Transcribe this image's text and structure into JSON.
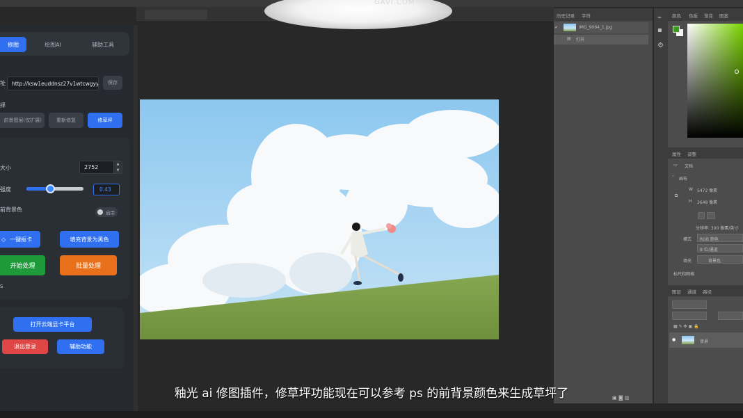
{
  "watermark": {
    "text": "GAVI.COM"
  },
  "plugin": {
    "tabs": [
      "修图",
      "绘图AI",
      "辅助工具"
    ],
    "url_label": "址",
    "url_value": "http://ksw1euddnsz27v1wtcwgyy",
    "save_label": "保存",
    "mode_label": "择",
    "mode_buttons": [
      "前景图层(仅扩展)",
      "重新修复",
      "修草坪"
    ],
    "size_label": "大小",
    "size_value": "2752",
    "strength_label": "强度",
    "strength_value": "0.43",
    "strength_fraction": 0.43,
    "fg_color_label": "前背景色",
    "toggle_label": "启用",
    "btn_one_click": "一键抠卡",
    "btn_fill_bg": "填充背景为黑色",
    "btn_start": "开始处理",
    "btn_batch": "批量处理",
    "stray_char": "S",
    "btn_open_cloud": "打开云端显卡平台",
    "btn_logout": "退出登录",
    "btn_repair": "辅助功能"
  },
  "subtitle": "釉光 ai 修图插件，修草坪功能现在可以参考 ps 的前背景颜色来生成草坪了",
  "ps": {
    "history_tabs": [
      "历史记录",
      "字符"
    ],
    "history_items": [
      "IMG_9064_1.jpg",
      "打开"
    ],
    "right_tabs": [
      "颜色",
      "色板",
      "渐变",
      "图案"
    ],
    "props_tabs": [
      "属性",
      "调整"
    ],
    "doc_label": "文档",
    "canvas_label": "画布",
    "w_label": "W",
    "w_value": "5472 像素",
    "h_label": "H",
    "h_value": "3648 像素",
    "resolution_text": "分辨率: 300 像素/英寸",
    "mode_label": "模式",
    "mode_value": "RGB 颜色",
    "depth_value": "8 位/通道",
    "fill_label": "填充",
    "fill_value": "背景色",
    "guide_label": "标尺和网格",
    "layers_tabs": [
      "图层",
      "通道",
      "路径"
    ],
    "layer_name": "背景"
  },
  "colors": {
    "accent": "#2f6ff0",
    "green": "#1f9a3a",
    "orange": "#e8701a",
    "red": "#e04646"
  }
}
